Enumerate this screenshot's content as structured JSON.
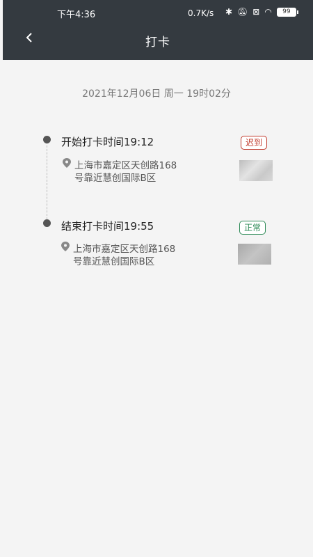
{
  "status_bar": {
    "time": "下午4:36",
    "network_speed": "0.7K/s",
    "battery": "99"
  },
  "header": {
    "title": "打卡",
    "back_icon": "chevron-left-icon"
  },
  "date_line": "2021年12月06日 周一 19时02分",
  "records": [
    {
      "title": "开始打卡时间19:12",
      "status": "迟到",
      "address_line1": "上海市嘉定区天创路168",
      "address_line2": "号靠近慧创国际B区"
    },
    {
      "title": "结束打卡时间19:55",
      "status": "正常",
      "address_line1": "上海市嘉定区天创路168",
      "address_line2": "号靠近慧创国际B区"
    }
  ],
  "colors": {
    "header_bg": "#343a40",
    "late": "#c0392b",
    "normal": "#2e8b57"
  }
}
